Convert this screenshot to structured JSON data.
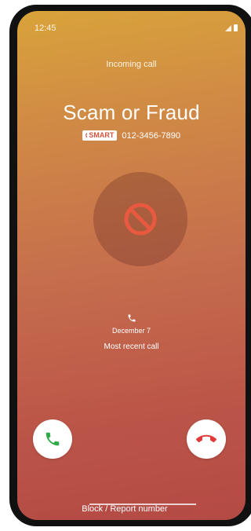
{
  "status_bar": {
    "time": "12:45",
    "icons": [
      "signal-icon",
      "battery-icon"
    ]
  },
  "call": {
    "incoming_label": "Incoming call",
    "caller_name": "Scam or Fraud",
    "badge_label": "SMART",
    "phone_number": "012-3456-7890",
    "avatar_icon": "block-icon"
  },
  "recent": {
    "icon": "phone-icon",
    "date": "December 7",
    "label": "Most recent call"
  },
  "actions": {
    "answer_icon": "phone-answer-icon",
    "decline_icon": "phone-decline-icon",
    "block_report_label": "Block / Report number"
  },
  "colors": {
    "accent_warning": "#e8593f",
    "answer_green": "#2faa4a",
    "decline_red": "#e03b3b"
  }
}
